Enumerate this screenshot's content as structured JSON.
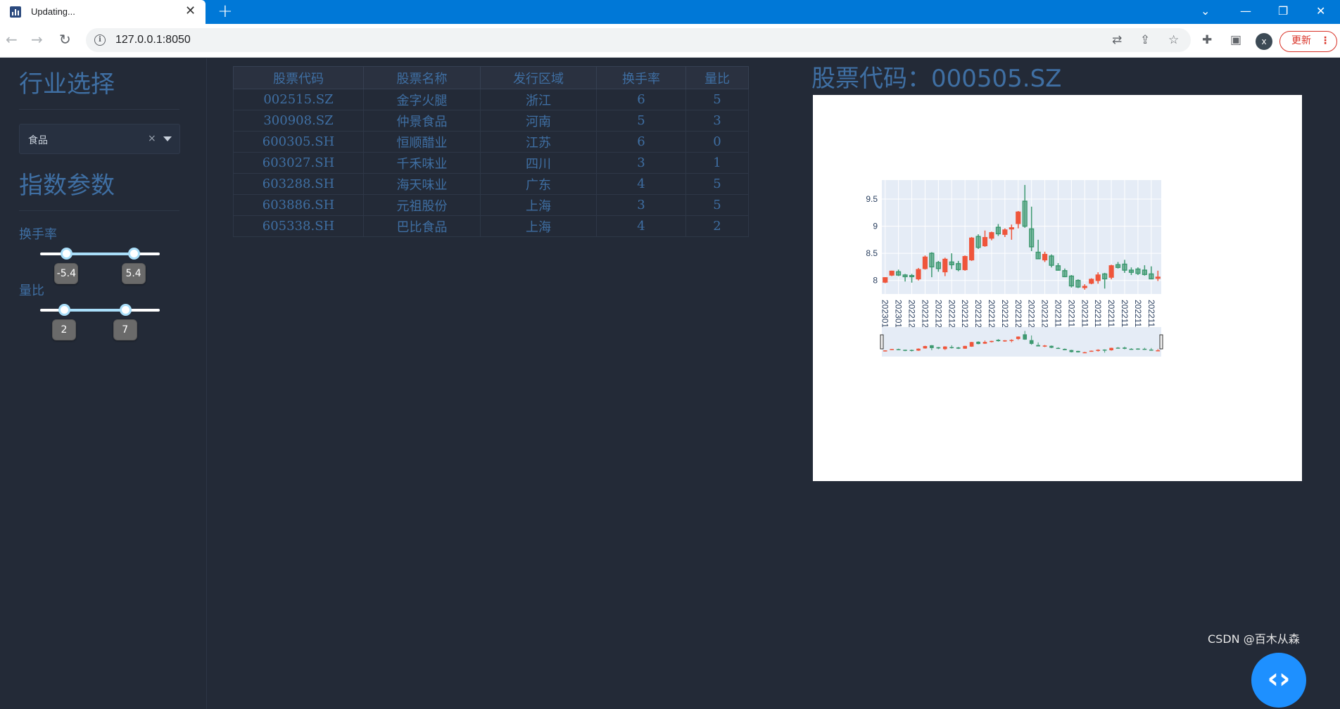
{
  "browser": {
    "tab_title": "Updating...",
    "url": "127.0.0.1:8050",
    "update_label": "更新",
    "profile_initial": "x"
  },
  "sidebar": {
    "industry_title": "行业选择",
    "dropdown_value": "食品",
    "params_title": "指数参数",
    "turnover_label": "换手率",
    "turnover_min": "-5.4",
    "turnover_max": "5.4",
    "turnover_range_fraction": [
      0.22,
      0.78
    ],
    "volume_label": "量比",
    "volume_min": "2",
    "volume_max": "7",
    "volume_range_fraction": [
      0.2,
      0.71
    ]
  },
  "table": {
    "headers": [
      "股票代码",
      "股票名称",
      "发行区域",
      "换手率",
      "量比"
    ],
    "rows": [
      [
        "002515.SZ",
        "金字火腿",
        "浙江",
        "6",
        "5"
      ],
      [
        "300908.SZ",
        "仲景食品",
        "河南",
        "5",
        "3"
      ],
      [
        "600305.SH",
        "恒顺醋业",
        "江苏",
        "6",
        "0"
      ],
      [
        "603027.SH",
        "千禾味业",
        "四川",
        "3",
        "1"
      ],
      [
        "603288.SH",
        "海天味业",
        "广东",
        "4",
        "5"
      ],
      [
        "603886.SH",
        "元祖股份",
        "上海",
        "3",
        "5"
      ],
      [
        "605338.SH",
        "巴比食品",
        "上海",
        "4",
        "2"
      ]
    ]
  },
  "chart_header": "股票代码：000505.SZ",
  "chart_data": {
    "type": "candlestick",
    "y_ticks": [
      "8",
      "8.5",
      "9",
      "9.5"
    ],
    "ylim": [
      7.75,
      9.85
    ],
    "x_tick_labels": [
      "20230106",
      "20230104",
      "20221230",
      "20221228",
      "20221226",
      "20221222",
      "20221220",
      "20221216",
      "20221214",
      "20221212",
      "20221208",
      "20221206",
      "20221202",
      "20221130",
      "20221128",
      "20221124",
      "20221122",
      "20221118",
      "20221116",
      "20221114",
      "20221110"
    ],
    "increasing_color": "#ef553b",
    "decreasing_color": "#3d9970",
    "candles": [
      {
        "o": 7.97,
        "h": 8.06,
        "l": 7.95,
        "c": 8.05
      },
      {
        "o": 8.1,
        "h": 8.18,
        "l": 8.08,
        "c": 8.17
      },
      {
        "o": 8.16,
        "h": 8.2,
        "l": 8.08,
        "c": 8.1
      },
      {
        "o": 8.1,
        "h": 8.12,
        "l": 7.98,
        "c": 8.07
      },
      {
        "o": 8.09,
        "h": 8.12,
        "l": 7.96,
        "c": 8.07
      },
      {
        "o": 8.03,
        "h": 8.23,
        "l": 8.0,
        "c": 8.2
      },
      {
        "o": 8.22,
        "h": 8.46,
        "l": 8.2,
        "c": 8.43
      },
      {
        "o": 8.5,
        "h": 8.52,
        "l": 8.06,
        "c": 8.25
      },
      {
        "o": 8.33,
        "h": 8.36,
        "l": 8.16,
        "c": 8.22
      },
      {
        "o": 8.16,
        "h": 8.42,
        "l": 8.08,
        "c": 8.39
      },
      {
        "o": 8.34,
        "h": 8.5,
        "l": 8.21,
        "c": 8.29
      },
      {
        "o": 8.31,
        "h": 8.36,
        "l": 8.17,
        "c": 8.2
      },
      {
        "o": 8.2,
        "h": 8.46,
        "l": 8.18,
        "c": 8.44
      },
      {
        "o": 8.38,
        "h": 8.8,
        "l": 8.36,
        "c": 8.78
      },
      {
        "o": 8.81,
        "h": 8.85,
        "l": 8.58,
        "c": 8.61
      },
      {
        "o": 8.64,
        "h": 8.92,
        "l": 8.62,
        "c": 8.79
      },
      {
        "o": 8.78,
        "h": 8.9,
        "l": 8.74,
        "c": 8.88
      },
      {
        "o": 8.98,
        "h": 9.04,
        "l": 8.82,
        "c": 8.86
      },
      {
        "o": 8.85,
        "h": 8.96,
        "l": 8.8,
        "c": 8.93
      },
      {
        "o": 8.95,
        "h": 9.03,
        "l": 8.75,
        "c": 8.97
      },
      {
        "o": 9.05,
        "h": 9.28,
        "l": 8.96,
        "c": 9.26
      },
      {
        "o": 9.46,
        "h": 9.76,
        "l": 8.97,
        "c": 9.0
      },
      {
        "o": 8.95,
        "h": 9.36,
        "l": 8.54,
        "c": 8.62
      },
      {
        "o": 8.52,
        "h": 8.75,
        "l": 8.4,
        "c": 8.4
      },
      {
        "o": 8.38,
        "h": 8.53,
        "l": 8.34,
        "c": 8.48
      },
      {
        "o": 8.45,
        "h": 8.48,
        "l": 8.24,
        "c": 8.28
      },
      {
        "o": 8.27,
        "h": 8.32,
        "l": 8.18,
        "c": 8.19
      },
      {
        "o": 8.18,
        "h": 8.22,
        "l": 8.06,
        "c": 8.07
      },
      {
        "o": 8.08,
        "h": 8.1,
        "l": 7.87,
        "c": 7.9
      },
      {
        "o": 8.0,
        "h": 8.02,
        "l": 7.86,
        "c": 7.88
      },
      {
        "o": 7.87,
        "h": 7.93,
        "l": 7.83,
        "c": 7.89
      },
      {
        "o": 7.95,
        "h": 8.04,
        "l": 7.93,
        "c": 8.02
      },
      {
        "o": 8.0,
        "h": 8.15,
        "l": 7.94,
        "c": 8.1
      },
      {
        "o": 8.12,
        "h": 8.14,
        "l": 7.85,
        "c": 8.03
      },
      {
        "o": 8.06,
        "h": 8.29,
        "l": 8.02,
        "c": 8.27
      },
      {
        "o": 8.29,
        "h": 8.34,
        "l": 8.22,
        "c": 8.24
      },
      {
        "o": 8.3,
        "h": 8.38,
        "l": 8.14,
        "c": 8.19
      },
      {
        "o": 8.19,
        "h": 8.24,
        "l": 8.1,
        "c": 8.15
      },
      {
        "o": 8.21,
        "h": 8.24,
        "l": 8.1,
        "c": 8.13
      },
      {
        "o": 8.19,
        "h": 8.28,
        "l": 8.09,
        "c": 8.11
      },
      {
        "o": 8.12,
        "h": 8.26,
        "l": 8.02,
        "c": 8.03
      },
      {
        "o": 8.05,
        "h": 8.18,
        "l": 7.99,
        "c": 8.06
      }
    ]
  }
}
